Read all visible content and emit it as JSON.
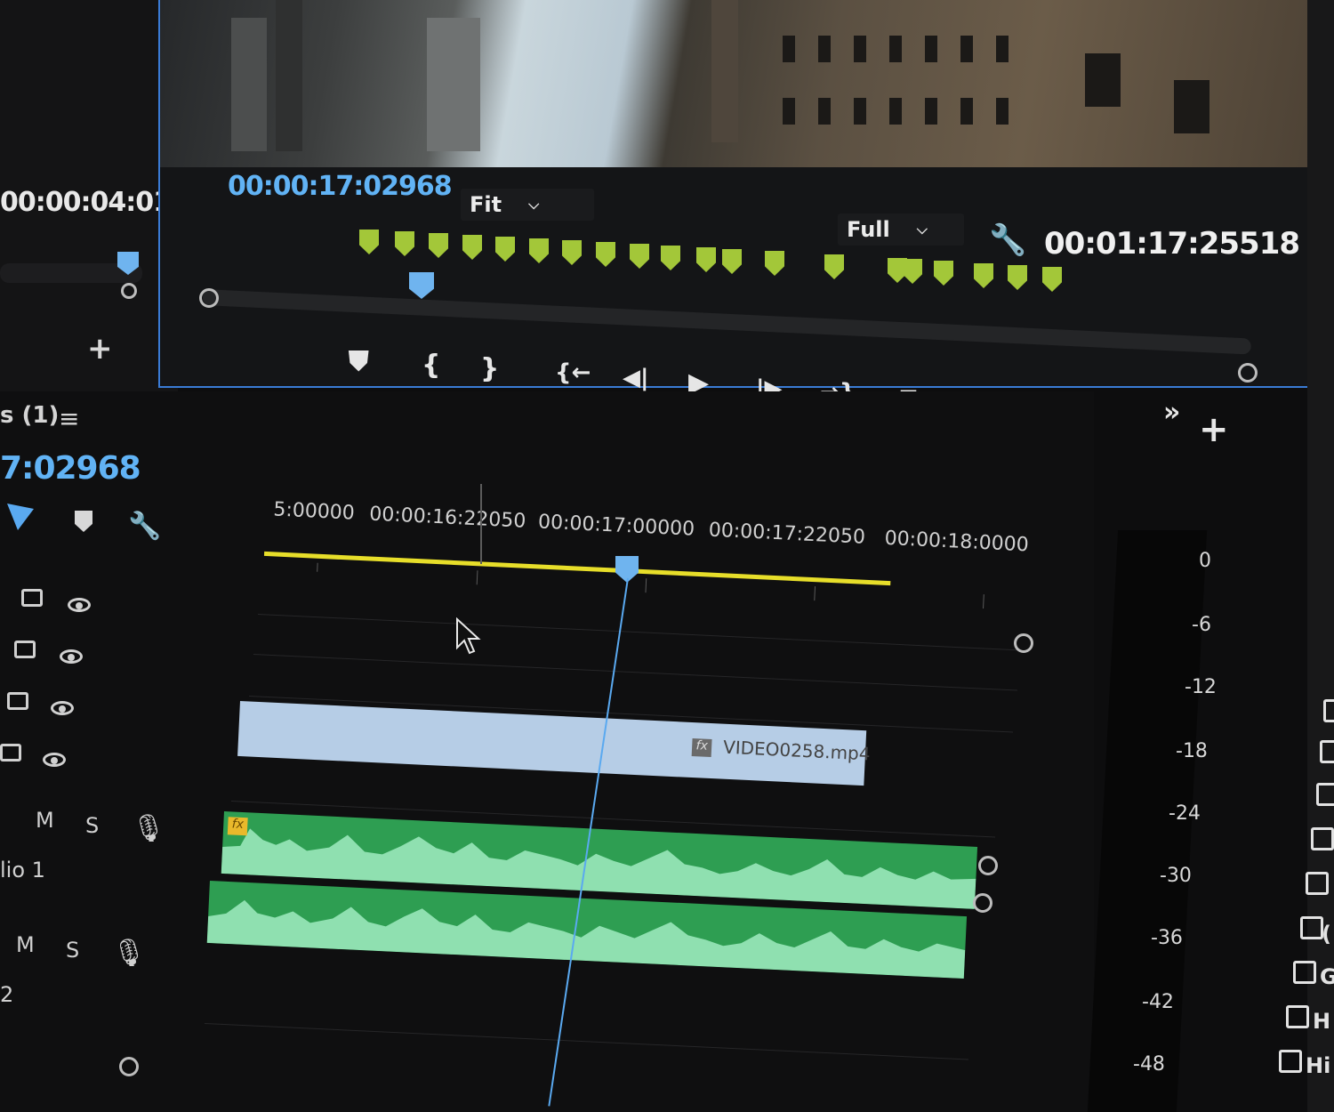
{
  "source_monitor": {
    "timecode": "00:00:04:01",
    "add_label": "+"
  },
  "program_monitor": {
    "timecode": "00:00:17:02968",
    "duration": "00:01:17:25518",
    "zoom_value": "Fit",
    "quality_value": "Full",
    "controls": {
      "add_marker": "⛊",
      "mark_in": "{",
      "mark_out": "}",
      "go_to_in": "{←",
      "step_back": "◀|",
      "play": "▶",
      "step_forward": "|▶",
      "go_to_out": "→}",
      "lift": "⧉",
      "extract": "⧉",
      "export_frame": "📷",
      "more": "»",
      "add": "+"
    }
  },
  "timeline": {
    "sequence_name": "s (1)",
    "timecode": "7:02968",
    "ruler_labels": [
      "5:00000",
      "00:00:16:22050",
      "00:00:17:00000",
      "00:00:17:22050",
      "00:00:18:0000"
    ],
    "video_clip": {
      "name": "VIDEO0258.mp4",
      "fx": "fx"
    },
    "audio_clip": {
      "fx": "fx"
    },
    "audio_tracks": [
      {
        "mute": "M",
        "solo": "S",
        "label": "lio 1"
      },
      {
        "mute": "M",
        "solo": "S",
        "label": "2"
      }
    ]
  },
  "audio_meter": {
    "scale": [
      "0",
      "-6",
      "-12",
      "-18",
      "-24",
      "-30",
      "-36",
      "-42",
      "-48"
    ]
  },
  "right_panel": {
    "items": [
      "",
      "",
      "",
      "",
      "",
      "",
      "",
      "(",
      "G",
      "H",
      "Hi",
      ""
    ]
  },
  "colors": {
    "accent_blue": "#61b3f5",
    "marker_green": "#a3c739",
    "work_area_yellow": "#e7de2a",
    "video_clip": "#b6cde6",
    "audio_clip": "#2e9e52",
    "panel_border": "#3a7bd5"
  }
}
